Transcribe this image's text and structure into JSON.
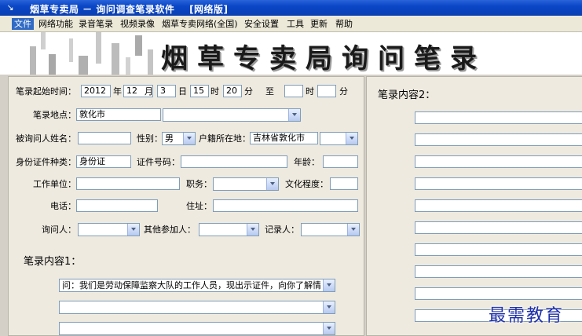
{
  "window": {
    "title": "烟草专卖局 － 询问调查笔录软件    [网络版]"
  },
  "menu": [
    "文件",
    "网络功能",
    "录音笔录",
    "视频录像",
    "烟草专卖网络(全国)",
    "安全设置",
    "工具",
    "更新",
    "帮助"
  ],
  "banner": {
    "title": "烟草专卖局询问笔录"
  },
  "form": {
    "start_time_label": "笔录起始时间：",
    "year": "2012",
    "year_unit": "年",
    "month": "12",
    "month_unit": "月",
    "day": "3",
    "day_unit": "日",
    "hour": "15",
    "hour_unit": "时",
    "minute": "20",
    "minute_unit": "分",
    "to_label": "至",
    "end_hour": "",
    "end_hour_unit": "时",
    "end_minute": "",
    "end_minute_unit": "分",
    "location_label": "笔录地点：",
    "location": "敦化市",
    "location_detail": "",
    "name_label": "被询问人姓名：",
    "name": "",
    "gender_label": "性别：",
    "gender": "男",
    "domicile_label": "户籍所在地：",
    "domicile": "吉林省敦化市",
    "domicile_extra": "",
    "id_type_label": "身份证件种类：",
    "id_type": "身份证",
    "id_no_label": "证件号码：",
    "id_no": "",
    "age_label": "年龄：",
    "age": "",
    "work_unit_label": "工作单位：",
    "work_unit": "",
    "position_label": "职务：",
    "position": "",
    "education_label": "文化程度：",
    "education": "",
    "phone_label": "电话：",
    "phone": "",
    "address_label": "住址：",
    "address": "",
    "interrogator_label": "询问人：",
    "interrogator": "",
    "others_label": "其他参加人：",
    "others": "",
    "recorder_label": "记录人：",
    "recorder": ""
  },
  "content1": {
    "title": "笔录内容1：",
    "lines": [
      "问：我们是劳动保障监察大队的工作人员，现出示证件，向你了解情况，",
      "",
      ""
    ]
  },
  "content2": {
    "title": "笔录内容2："
  },
  "watermark": "最需教育"
}
